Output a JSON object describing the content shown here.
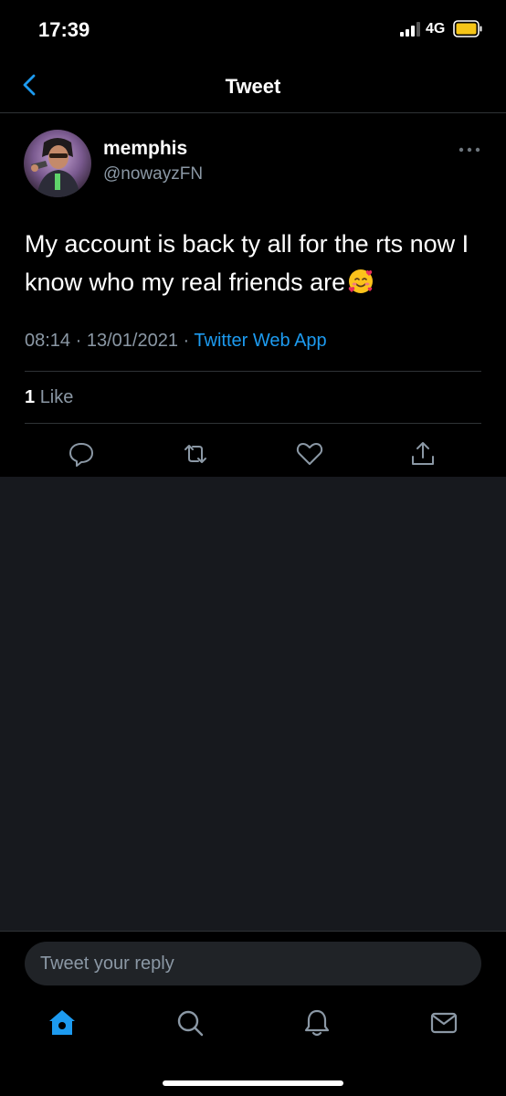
{
  "status_bar": {
    "time": "17:39",
    "network": "4G",
    "battery_color": "#f5c518"
  },
  "header": {
    "title": "Tweet",
    "accent": "#1d9bf0"
  },
  "tweet": {
    "display_name": "memphis",
    "handle": "@nowayzFN",
    "text": "My account is back ty all for the rts now I know who my real friends are",
    "emoji": "smiling-face-with-hearts",
    "time": "08:14",
    "separator": "·",
    "date": "13/01/2021",
    "source": "Twitter Web App",
    "like_count": "1",
    "like_label": "Like"
  },
  "composer": {
    "placeholder": "Tweet your reply"
  },
  "tab_bar": {
    "items": [
      "home-icon",
      "search-icon",
      "notifications-icon",
      "messages-icon"
    ],
    "active": "home-icon"
  }
}
